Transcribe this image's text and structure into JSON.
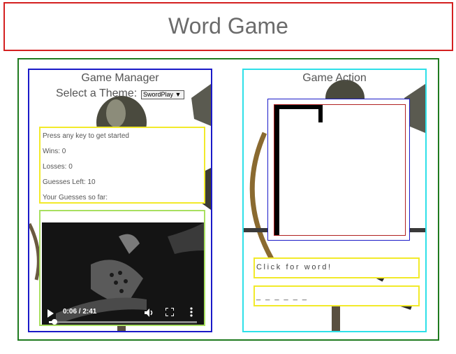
{
  "header": {
    "title": "Word Game"
  },
  "manager": {
    "title": "Game Manager",
    "theme_label": "Select a Theme:",
    "theme_value": "SwordPlay ▼",
    "stats": {
      "prompt": "Press any key to get started",
      "wins": "Wins: 0",
      "losses": "Losses: 0",
      "guesses_left": "Guesses Left: 10",
      "guesses_so_far": "Your Guesses so far:"
    },
    "video": {
      "time": "0:06 / 2:41",
      "progress_fraction": 0.037,
      "icons": [
        "play-icon",
        "volume-icon",
        "fullscreen-icon",
        "more-options-icon"
      ]
    }
  },
  "action": {
    "title": "Game Action",
    "word_prompt": "Click for word!",
    "word_display": "_ _ _ _ _ _"
  },
  "colors": {
    "title_border": "#d42020",
    "main_border": "#1f7a1f",
    "manager_border": "#1a1ac8",
    "action_border": "#2ee0e8",
    "stats_border": "#f2ea2a",
    "video_border": "#a8e060"
  }
}
